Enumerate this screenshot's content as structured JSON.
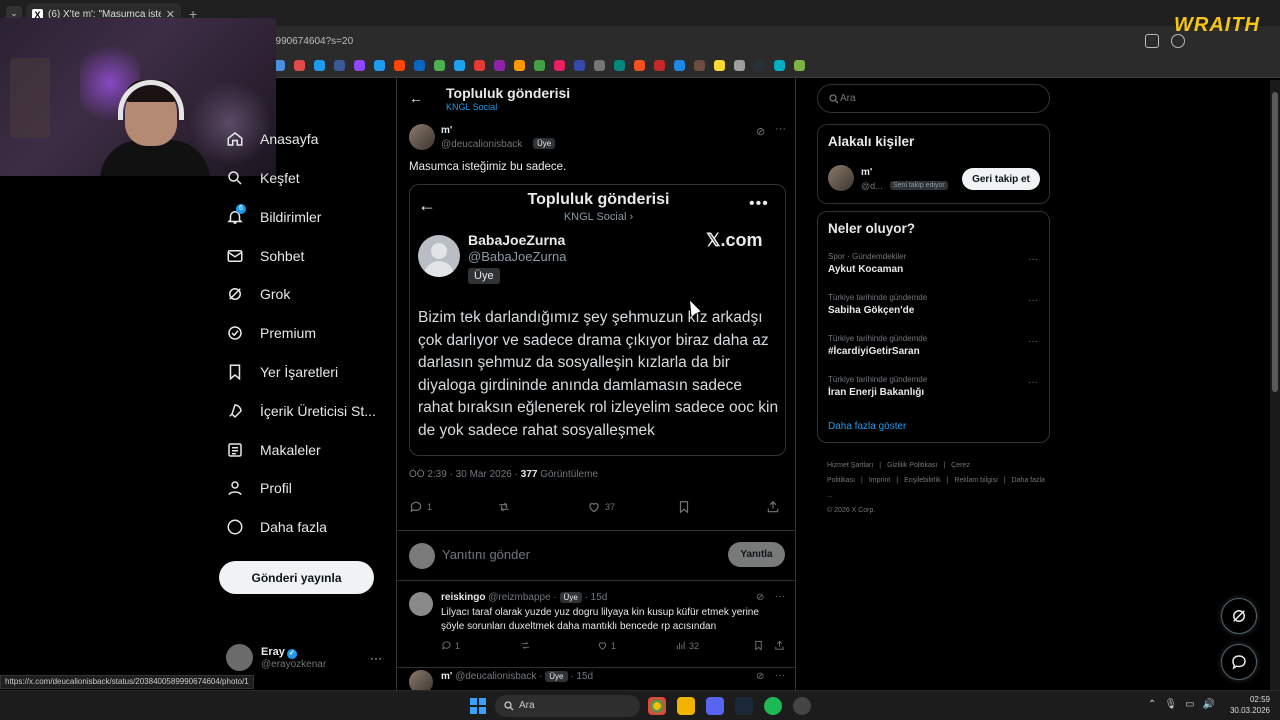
{
  "browser": {
    "tab_title": "(6) X'te m': \"Masumca isteğimiz",
    "url_fragment": "9990674604?s=20",
    "overlay_brand": "WRAITH",
    "status_link": "https://x.com/deucalionisback/status/2038400589990674604/photo/1"
  },
  "nav": {
    "items": [
      {
        "label": "Anasayfa",
        "icon": "home-icon"
      },
      {
        "label": "Keşfet",
        "icon": "search-icon"
      },
      {
        "label": "Bildirimler",
        "icon": "bell-icon",
        "badge": "6"
      },
      {
        "label": "Sohbet",
        "icon": "mail-icon"
      },
      {
        "label": "Grok",
        "icon": "grok-icon"
      },
      {
        "label": "Premium",
        "icon": "premium-icon"
      },
      {
        "label": "Yer İşaretleri",
        "icon": "bookmark-icon"
      },
      {
        "label": "İçerik Üreticisi St...",
        "icon": "rocket-icon"
      },
      {
        "label": "Makaleler",
        "icon": "article-icon"
      },
      {
        "label": "Profil",
        "icon": "person-icon"
      },
      {
        "label": "Daha fazla",
        "icon": "more-circle-icon"
      }
    ],
    "post_button": "Gönderi yayınla",
    "profile": {
      "name": "Eray",
      "handle": "@erayozkenar"
    }
  },
  "header": {
    "title": "Topluluk gönderisi",
    "subtitle": "KNGL Social"
  },
  "post": {
    "name": "m'",
    "handle": "@deucalionisback",
    "badge": "Üye",
    "text": "Masumca isteğimiz bu sadece.",
    "timestamp": "ÖÖ 2:39 · 30 Mar 2026 ·",
    "views": "377",
    "views_label": "Görüntüleme",
    "replies": "1",
    "likes": "37"
  },
  "embed": {
    "title": "Topluluk gönderisi",
    "subtitle": "KNGL Social ›",
    "name": "BabaJoeZurna",
    "handle": "@BabaJoeZurna",
    "badge": "Üye",
    "brand": "𝕏.com",
    "body": "Bizim tek darlandığımız şey şehmuzun kız arkadşı çok darlıyor ve sadece drama çıkıyor biraz daha az darlasın şehmuz da sosyalleşin kızlarla da bir diyaloga girdininde anında damlamasın sadece rahat bıraksın eğlenerek rol izleyelim sadece ooc kin de yok sadece rahat sosyalleşmek"
  },
  "reply_box": {
    "placeholder": "Yanıtını gönder",
    "button": "Yanıtla"
  },
  "replies": [
    {
      "name": "reiskingo",
      "handle": "@reizmbappe",
      "badge": "Üye",
      "time": "· 15d",
      "text": "Lilyacı taraf olarak yuzde yuz dogru lilyaya kin kusup küfür etmek yerine şöyle sorunları duxeltmek daha mantıklı bencede rp acısından",
      "replies": "1",
      "likes": "1",
      "views": "32"
    },
    {
      "name": "m'",
      "handle": "@deucalionisback",
      "badge": "Üye",
      "time": "· 15d"
    }
  ],
  "right": {
    "search_placeholder": "Ara",
    "related_title": "Alakalı kişiler",
    "related": {
      "name": "m'",
      "handle": "@d...",
      "badge": "Seni takip ediyor",
      "button": "Geri takip et"
    },
    "trends_title": "Neler oluyor?",
    "trends": [
      {
        "context": "Spor · Gündemdekiler",
        "title": "Aykut Kocaman"
      },
      {
        "context": "Türkiye tarihinde gündemde",
        "title": "Sabiha Gökçen'de"
      },
      {
        "context": "Türkiye tarihinde gündemde",
        "title": "#İcardiyiGetirSaran"
      },
      {
        "context": "Türkiye tarihinde gündemde",
        "title": "İran Enerji Bakanlığı"
      }
    ],
    "show_more": "Daha fazla göster",
    "footer": [
      "Hizmet Şartları",
      "|",
      "Gizlilik Politikası",
      "|",
      "Çerez Politikası",
      "|",
      "Imprint",
      "|",
      "Erişilebilirlik",
      "|",
      "Reklam bilgisi",
      "|",
      "Daha fazla ...",
      "© 2026 X Corp."
    ]
  },
  "taskbar": {
    "search_label": "Ara",
    "time": "02:59",
    "date": "30.03.2026"
  },
  "colors": {
    "accent": "#1d9bf0",
    "background": "#000000",
    "border": "#2f3336"
  }
}
